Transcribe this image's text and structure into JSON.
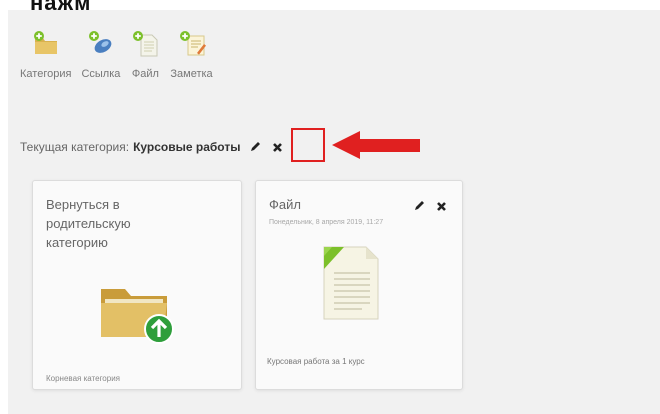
{
  "cut_heading": "нажм",
  "toolbar": {
    "items": [
      {
        "label": "Категория",
        "icon": "folder-add-icon"
      },
      {
        "label": "Ссылка",
        "icon": "link-add-icon"
      },
      {
        "label": "Файл",
        "icon": "file-add-icon"
      },
      {
        "label": "Заметка",
        "icon": "note-add-icon"
      }
    ]
  },
  "current_category": {
    "label": "Текущая категория:",
    "name": "Курсовые работы",
    "edit_icon": "pencil-icon",
    "delete_icon": "close-x-icon"
  },
  "annotation": {
    "color": "#e02020"
  },
  "cards": {
    "back": {
      "title": "Вернуться в родительскую категорию",
      "footer": "Корневая категория",
      "icon": "folder-up-icon"
    },
    "file": {
      "title": "Файл",
      "date": "Понедельник, 8 апреля 2019, 11:27",
      "footer": "Курсовая работа за 1 курс",
      "icon": "document-icon"
    }
  },
  "colors": {
    "panel_bg": "#f1f1f1",
    "accent_green": "#7cc02a",
    "folder": "#d8b65a",
    "arrow_red": "#e02020"
  }
}
